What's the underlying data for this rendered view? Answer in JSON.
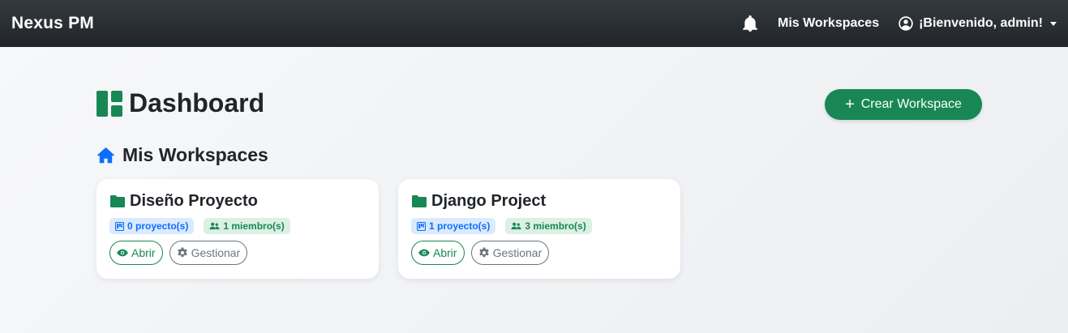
{
  "navbar": {
    "brand": "Nexus PM",
    "workspaces_link": "Mis Workspaces",
    "user_greeting": "¡Bienvenido, admin!"
  },
  "page": {
    "title": "Dashboard",
    "create_button": "Crear Workspace",
    "section_title": "Mis Workspaces"
  },
  "workspaces": [
    {
      "name": "Diseño Proyecto",
      "projects": "0 proyecto(s)",
      "members": "1 miembro(s)",
      "open_label": "Abrir",
      "manage_label": "Gestionar"
    },
    {
      "name": "Django Project",
      "projects": "1 proyecto(s)",
      "members": "3 miembro(s)",
      "open_label": "Abrir",
      "manage_label": "Gestionar"
    }
  ],
  "icons": [
    "bell-icon",
    "user-circle-icon",
    "dashboard-icon",
    "plus-icon",
    "home-icon",
    "folder-icon",
    "kanban-icon",
    "people-icon",
    "eye-icon",
    "gear-icon"
  ],
  "colors": {
    "primary_green": "#198754",
    "primary_blue": "#0d6efd",
    "navbar_dark": "#212529",
    "muted": "#6c757d"
  }
}
